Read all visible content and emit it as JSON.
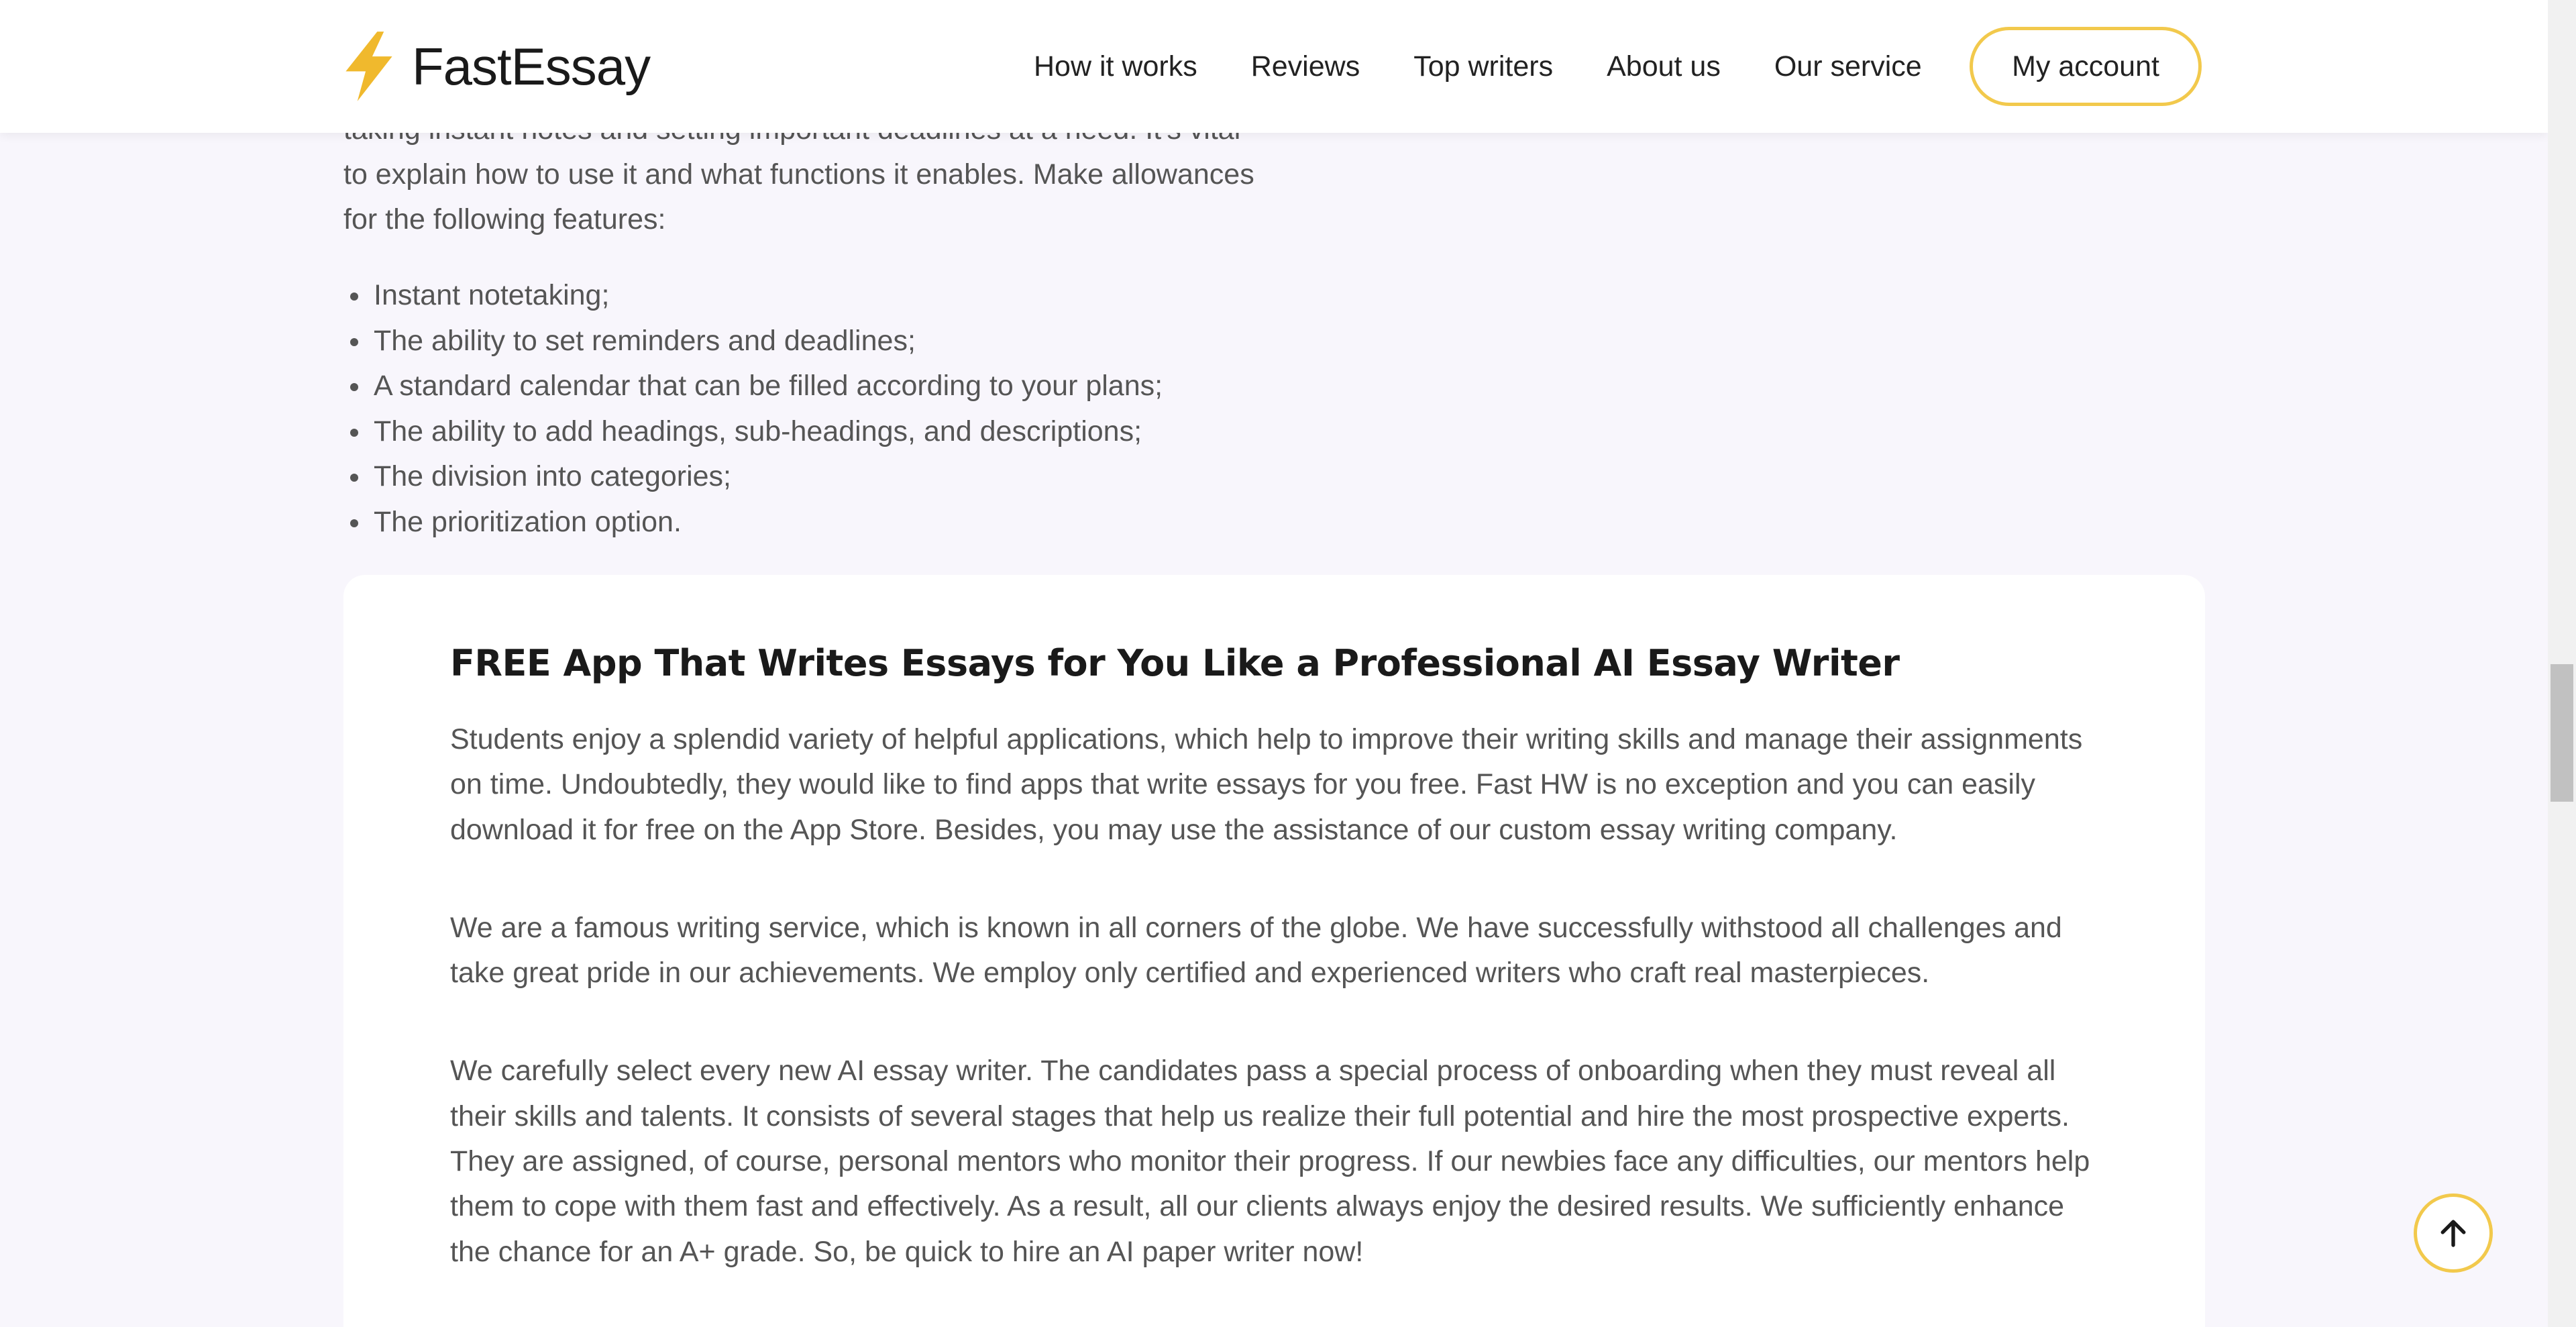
{
  "header": {
    "logo_text": "FastEssay",
    "nav": [
      {
        "label": "How it works"
      },
      {
        "label": "Reviews"
      },
      {
        "label": "Top writers"
      },
      {
        "label": "About us"
      },
      {
        "label": "Our service"
      }
    ],
    "account_label": "My account"
  },
  "intro": {
    "text": "taking instant notes and setting important deadlines at a need. It's vital to explain how to use it and what functions it enables. Make allowances for the following features:"
  },
  "features": [
    {
      "text": "Instant notetaking;"
    },
    {
      "text": "The ability to set reminders and deadlines;"
    },
    {
      "text": "A standard calendar that can be filled according to your plans;"
    },
    {
      "text": "The ability to add headings, sub-headings, and descriptions;"
    },
    {
      "text": "The division into categories;"
    },
    {
      "text": "The prioritization option."
    }
  ],
  "card": {
    "title": "FREE App That Writes Essays for You Like a Professional AI Essay Writer",
    "paragraphs": [
      {
        "text": "Students enjoy a splendid variety of helpful applications, which help to improve their writing skills and manage their assignments on time. Undoubtedly, they would like to find apps that write essays for you free. Fast HW is no exception and you can easily download it for free on the App Store. Besides, you may use the assistance of our custom essay writing company."
      },
      {
        "text": "We are a famous writing service, which is known in all corners of the globe. We have successfully withstood all challenges and take great pride in our achievements. We employ only certified and experienced writers who craft real masterpieces."
      },
      {
        "text": "We carefully select every new AI essay writer. The candidates pass a special process of onboarding when they must reveal all their skills and talents. It consists of several stages that help us realize their full potential and hire the most prospective experts. They are assigned, of course, personal mentors who monitor their progress. If our newbies face any difficulties, our mentors help them to cope with them fast and effectively. As a result, all our clients always enjoy the desired results. We sufficiently enhance the chance for an A+ grade. So, be quick to hire an AI paper writer now!"
      }
    ]
  },
  "icons": {
    "logo": "lightning-bolt-icon",
    "scroll_top": "arrow-up-icon"
  },
  "colors": {
    "accent": "#f2c94c",
    "logo_bolt": "#f0b92d",
    "page_background": "#f8f6fc",
    "card_background": "#ffffff",
    "heading": "#1a1a1a",
    "body_text": "#555555"
  },
  "scrollbar": {
    "position_fraction": 0.5
  }
}
